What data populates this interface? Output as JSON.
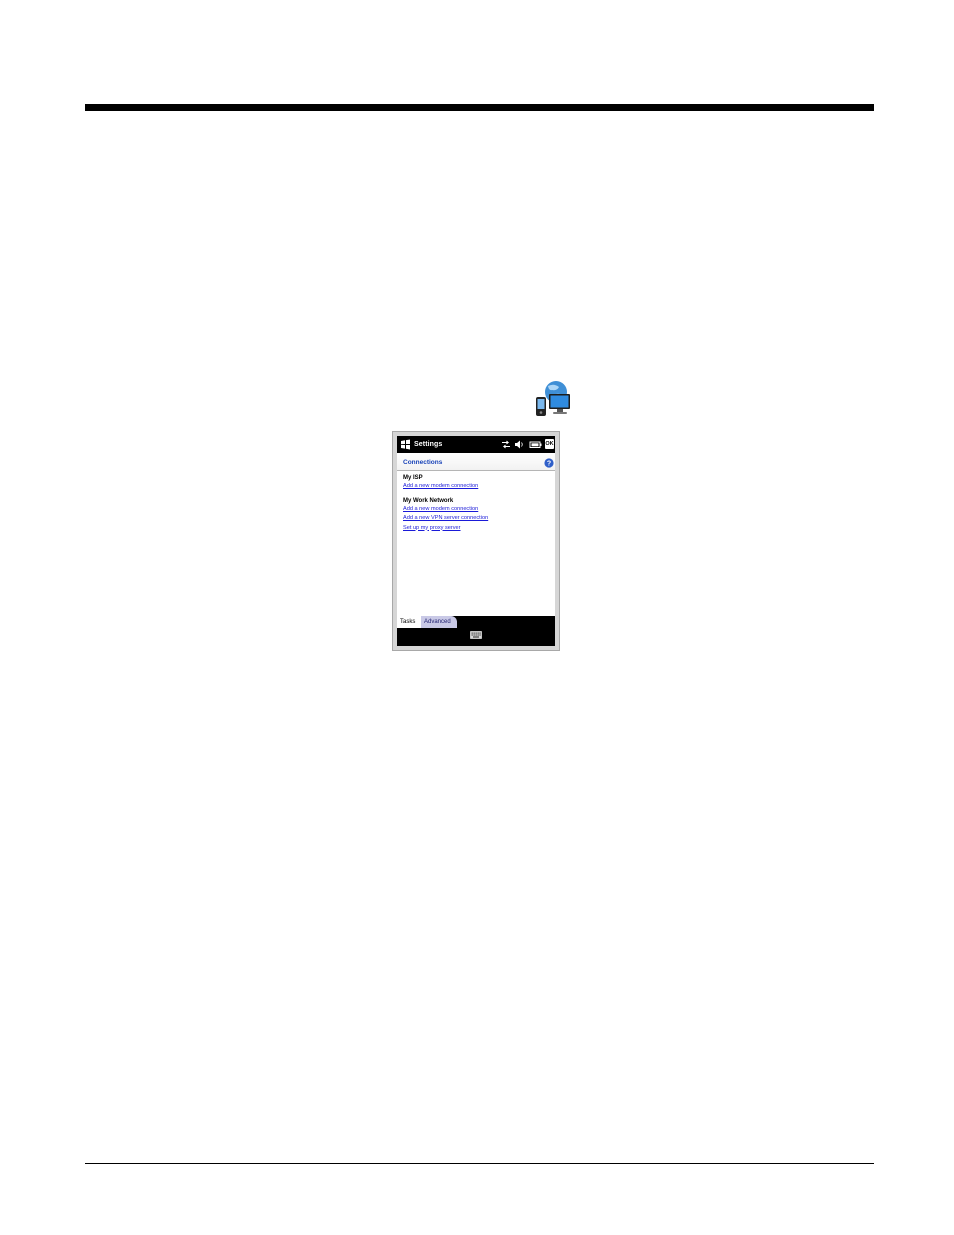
{
  "titlebar": {
    "title": "Settings",
    "ok_label": "OK",
    "icons": [
      "windows-flag-icon",
      "connectivity-icon",
      "volume-icon",
      "battery-icon"
    ]
  },
  "header": {
    "title": "Connections",
    "help_icon": "help-icon"
  },
  "sections": [
    {
      "title": "My ISP",
      "links": [
        "Add a new modem connection"
      ]
    },
    {
      "title": "My Work Network",
      "links": [
        "Add a new modem connection",
        "Add a new VPN server connection",
        "Set up my proxy server"
      ]
    }
  ],
  "tabs": [
    {
      "label": "Tasks"
    },
    {
      "label": "Advanced"
    }
  ],
  "colors": {
    "link": "#1a1ad8",
    "header_title": "#1a44b8",
    "titlebar_bg": "#000000",
    "tab_inactive_bg": "#c9c9e6"
  }
}
